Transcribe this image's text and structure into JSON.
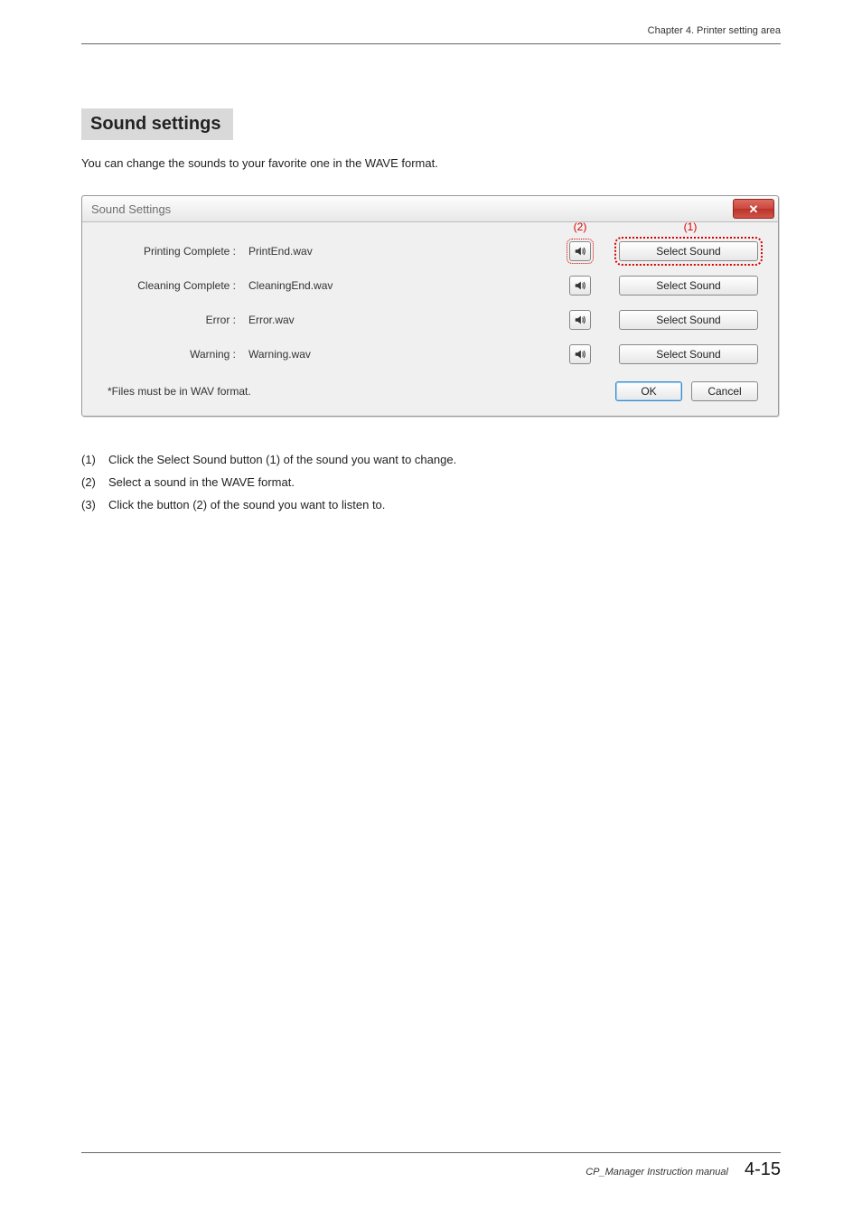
{
  "header": {
    "chapter": "Chapter 4. Printer setting area"
  },
  "section": {
    "title": "Sound settings",
    "intro": "You can change the sounds to your favorite one in the WAVE format."
  },
  "dialog": {
    "title": "Sound Settings",
    "close_glyph": "✕",
    "annotations": {
      "play": "(2)",
      "select": "(1)"
    },
    "rows": [
      {
        "label": "Printing Complete   :",
        "file": "PrintEnd.wav",
        "select_label": "Select Sound",
        "focused": true
      },
      {
        "label": "Cleaning Complete   :",
        "file": "CleaningEnd.wav",
        "select_label": "Select Sound",
        "focused": false
      },
      {
        "label": "Error   :",
        "file": "Error.wav",
        "select_label": "Select Sound",
        "focused": false
      },
      {
        "label": "Warning   :",
        "file": "Warning.wav",
        "select_label": "Select Sound",
        "focused": false
      }
    ],
    "note": "*Files must be in WAV format.",
    "ok_label": "OK",
    "cancel_label": "Cancel"
  },
  "steps": [
    {
      "num": "(1)",
      "text": "Click the Select Sound button (1) of the sound you want to change."
    },
    {
      "num": "(2)",
      "text": "Select a sound in the WAVE format."
    },
    {
      "num": "(3)",
      "text": "Click the button (2) of the sound you want to listen to."
    }
  ],
  "footer": {
    "docname": "CP_Manager Instruction manual",
    "page": "4-15"
  }
}
